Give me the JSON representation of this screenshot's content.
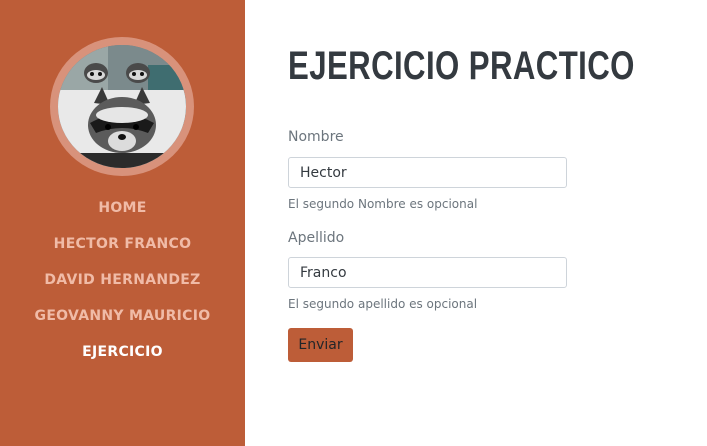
{
  "sidebar": {
    "avatar_alt": "raccoon-photo",
    "items": [
      {
        "label": "HOME"
      },
      {
        "label": "HECTOR FRANCO"
      },
      {
        "label": "DAVID HERNANDEZ"
      },
      {
        "label": "GEOVANNY MAURICIO"
      },
      {
        "label": "EJERCICIO"
      }
    ],
    "active_item": "EJERCICIO"
  },
  "main": {
    "title": "EJERCICIO PRACTICO",
    "form": {
      "nombre_label": "Nombre",
      "nombre_value": "Hector",
      "nombre_help": "El segundo Nombre es opcional",
      "apellido_label": "Apellido",
      "apellido_value": "Franco",
      "apellido_help": "El segundo apellido es opcional",
      "submit_label": "Enviar"
    }
  },
  "colors": {
    "sidebar_bg": "#bd5d38",
    "nav_text": "#f0bba7",
    "nav_active": "#ffffff",
    "title": "#343a40",
    "button_bg": "#bd5d38"
  }
}
